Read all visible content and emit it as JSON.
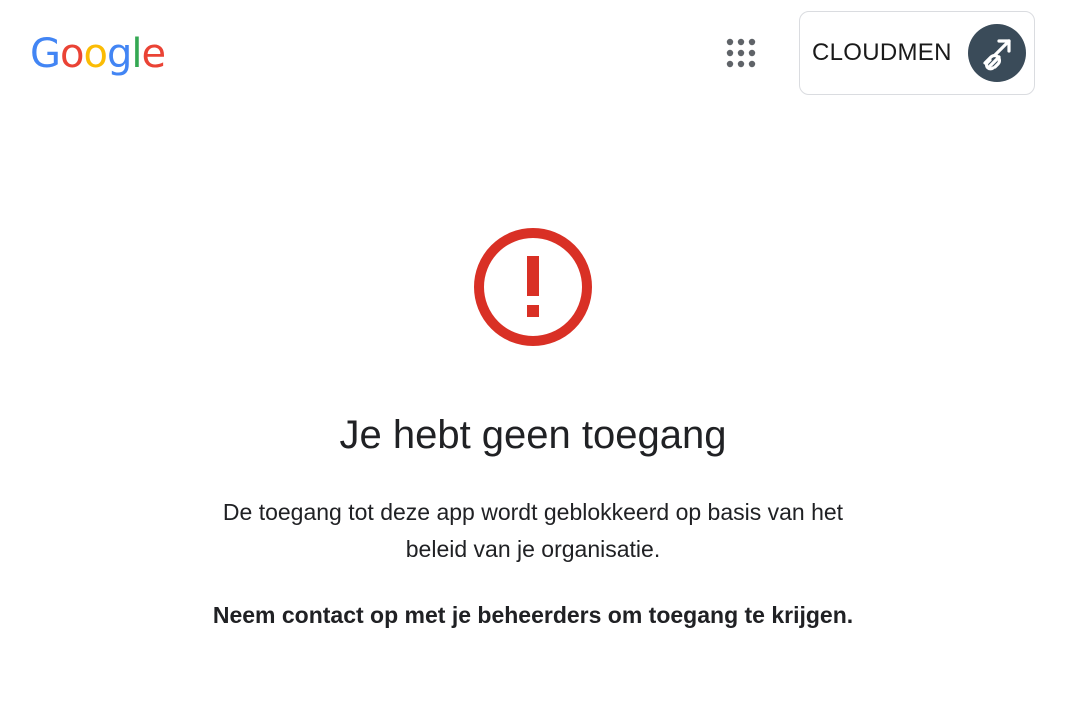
{
  "header": {
    "logo_letters": [
      {
        "char": "G",
        "color": "#4285F4"
      },
      {
        "char": "o",
        "color": "#EA4335"
      },
      {
        "char": "o",
        "color": "#FBBC05"
      },
      {
        "char": "g",
        "color": "#4285F4"
      },
      {
        "char": "l",
        "color": "#34A853"
      },
      {
        "char": "e",
        "color": "#EA4335"
      }
    ],
    "apps_icon": "grid-apps-icon",
    "account": {
      "org_name": "CLOUDMEN",
      "avatar_icon": "arrow-link-icon",
      "avatar_color": "#3a4b59"
    }
  },
  "main": {
    "error_icon": "exclamation-circle-icon",
    "error_color": "#d93025",
    "title": "Je hebt geen toegang",
    "message_line1": "De toegang tot deze app wordt geblokkeerd op basis van het",
    "message_line2": "beleid van je organisatie.",
    "contact": "Neem contact op met je beheerders om toegang te krijgen."
  }
}
